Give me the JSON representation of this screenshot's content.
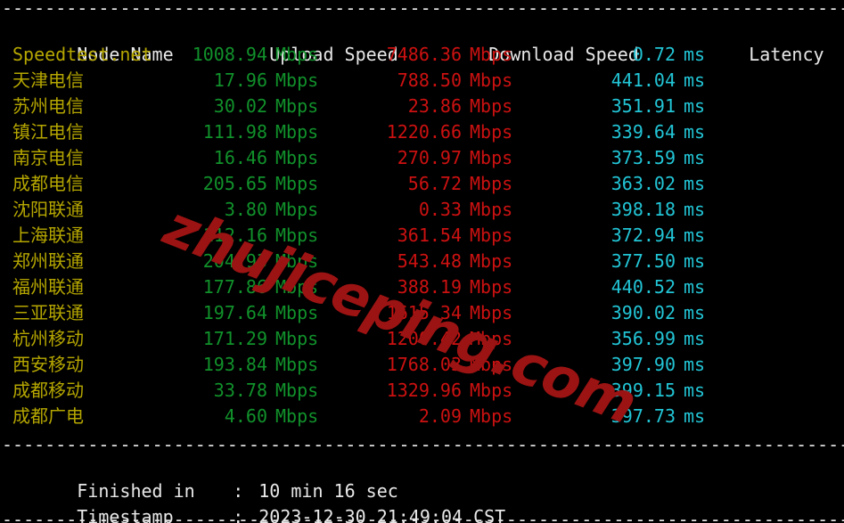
{
  "terminal": {
    "separator": "---------------------------------------------------------------------------------------",
    "background_color": "#000000"
  },
  "colors": {
    "node": "#b5a600",
    "upload": "#11912b",
    "download": "#cc1111",
    "latency": "#22c5d6",
    "header": "#e8e8e8",
    "watermark": "#9c1313"
  },
  "table": {
    "headers": {
      "node": "Node Name",
      "upload": "Upload Speed",
      "download": "Download Speed",
      "latency": "Latency"
    },
    "units": {
      "speed": "Mbps",
      "latency": "ms"
    },
    "rows": [
      {
        "node": "Speedtest.net",
        "upload": "1008.94",
        "download": "7486.36",
        "latency": "0.72"
      },
      {
        "node": "天津电信",
        "upload": "17.96",
        "download": "788.50",
        "latency": "441.04"
      },
      {
        "node": "苏州电信",
        "upload": "30.02",
        "download": "23.86",
        "latency": "351.91"
      },
      {
        "node": "镇江电信",
        "upload": "111.98",
        "download": "1220.66",
        "latency": "339.64"
      },
      {
        "node": "南京电信",
        "upload": "16.46",
        "download": "270.97",
        "latency": "373.59"
      },
      {
        "node": "成都电信",
        "upload": "205.65",
        "download": "56.72",
        "latency": "363.02"
      },
      {
        "node": "沈阳联通",
        "upload": "3.80",
        "download": "0.33",
        "latency": "398.18"
      },
      {
        "node": "上海联通",
        "upload": "112.16",
        "download": "361.54",
        "latency": "372.94"
      },
      {
        "node": "郑州联通",
        "upload": "204.93",
        "download": "543.48",
        "latency": "377.50"
      },
      {
        "node": "福州联通",
        "upload": "177.86",
        "download": "388.19",
        "latency": "440.52"
      },
      {
        "node": "三亚联通",
        "upload": "197.64",
        "download": "1615.34",
        "latency": "390.02"
      },
      {
        "node": "杭州移动",
        "upload": "171.29",
        "download": "1200.42",
        "latency": "356.99"
      },
      {
        "node": "西安移动",
        "upload": "193.84",
        "download": "1768.03",
        "latency": "397.90"
      },
      {
        "node": "成都移动",
        "upload": "33.78",
        "download": "1329.96",
        "latency": "399.15"
      },
      {
        "node": "成都广电",
        "upload": "4.60",
        "download": "2.09",
        "latency": "397.73"
      }
    ]
  },
  "footer": {
    "colon": ":",
    "finished_label": "Finished in",
    "finished_value": "10 min 16 sec",
    "timestamp_label": "Timestamp",
    "timestamp_value": "2023-12-30 21:49:04 CST"
  },
  "watermark": {
    "text": "zhujiceping.com"
  }
}
